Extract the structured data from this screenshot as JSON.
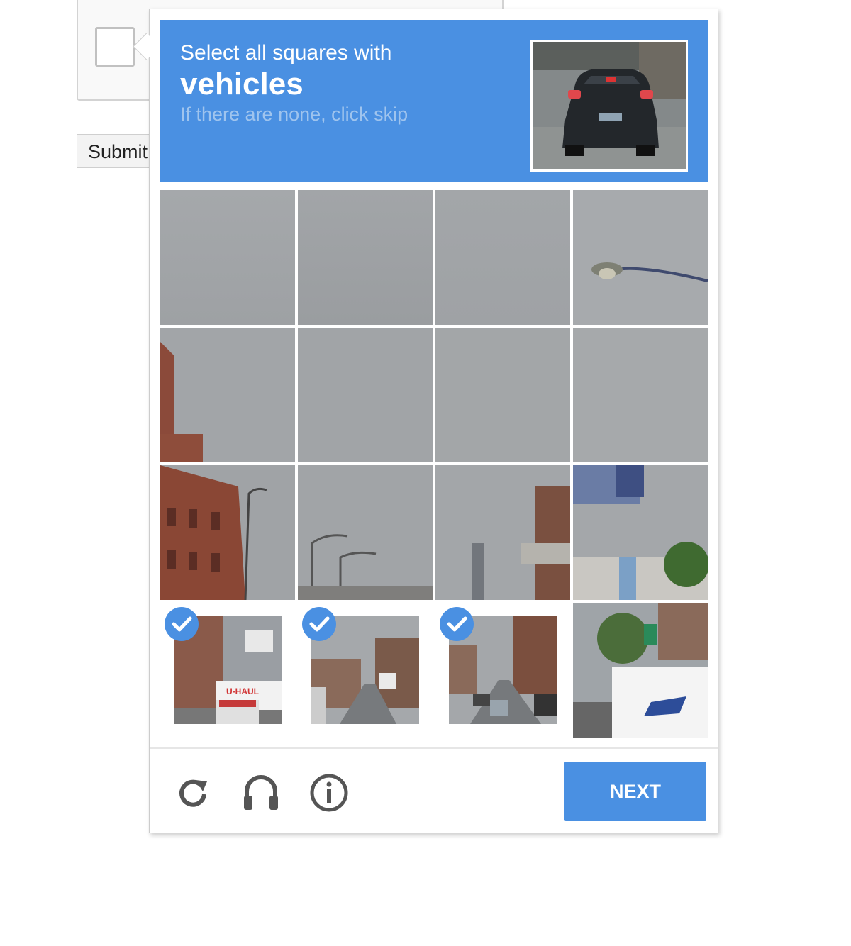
{
  "page": {
    "submit_label": "Submit"
  },
  "challenge": {
    "line1": "Select all squares with",
    "target_word": "vehicles",
    "hint": "If there are none, click skip",
    "sample_image": "rear view of dark hatchback car",
    "tiles": [
      {
        "index": 1,
        "content": "overcast sky",
        "selected": false
      },
      {
        "index": 2,
        "content": "overcast sky",
        "selected": false
      },
      {
        "index": 3,
        "content": "overcast sky",
        "selected": false
      },
      {
        "index": 4,
        "content": "sky with street lamp",
        "selected": false
      },
      {
        "index": 5,
        "content": "sky with brick building edge",
        "selected": false
      },
      {
        "index": 6,
        "content": "overcast sky",
        "selected": false
      },
      {
        "index": 7,
        "content": "overcast sky",
        "selected": false
      },
      {
        "index": 8,
        "content": "overcast sky",
        "selected": false
      },
      {
        "index": 9,
        "content": "brick building and street lamp",
        "selected": false
      },
      {
        "index": 10,
        "content": "street lamps",
        "selected": false
      },
      {
        "index": 11,
        "content": "distant skyline and billboard",
        "selected": false
      },
      {
        "index": 12,
        "content": "billboard and trees",
        "selected": false
      },
      {
        "index": 13,
        "content": "street with U-HAUL truck",
        "selected": true
      },
      {
        "index": 14,
        "content": "street with cars",
        "selected": true
      },
      {
        "index": 15,
        "content": "street with cars and traffic lights",
        "selected": true
      },
      {
        "index": 16,
        "content": "USPS mail truck",
        "selected": false
      }
    ],
    "uhaul_text": "U-HAUL",
    "next_label": "NEXT",
    "colors": {
      "accent": "#4a90e2",
      "hint": "#9fc4ee"
    },
    "footer_icons": [
      "reload-icon",
      "headphones-icon",
      "info-icon"
    ]
  }
}
